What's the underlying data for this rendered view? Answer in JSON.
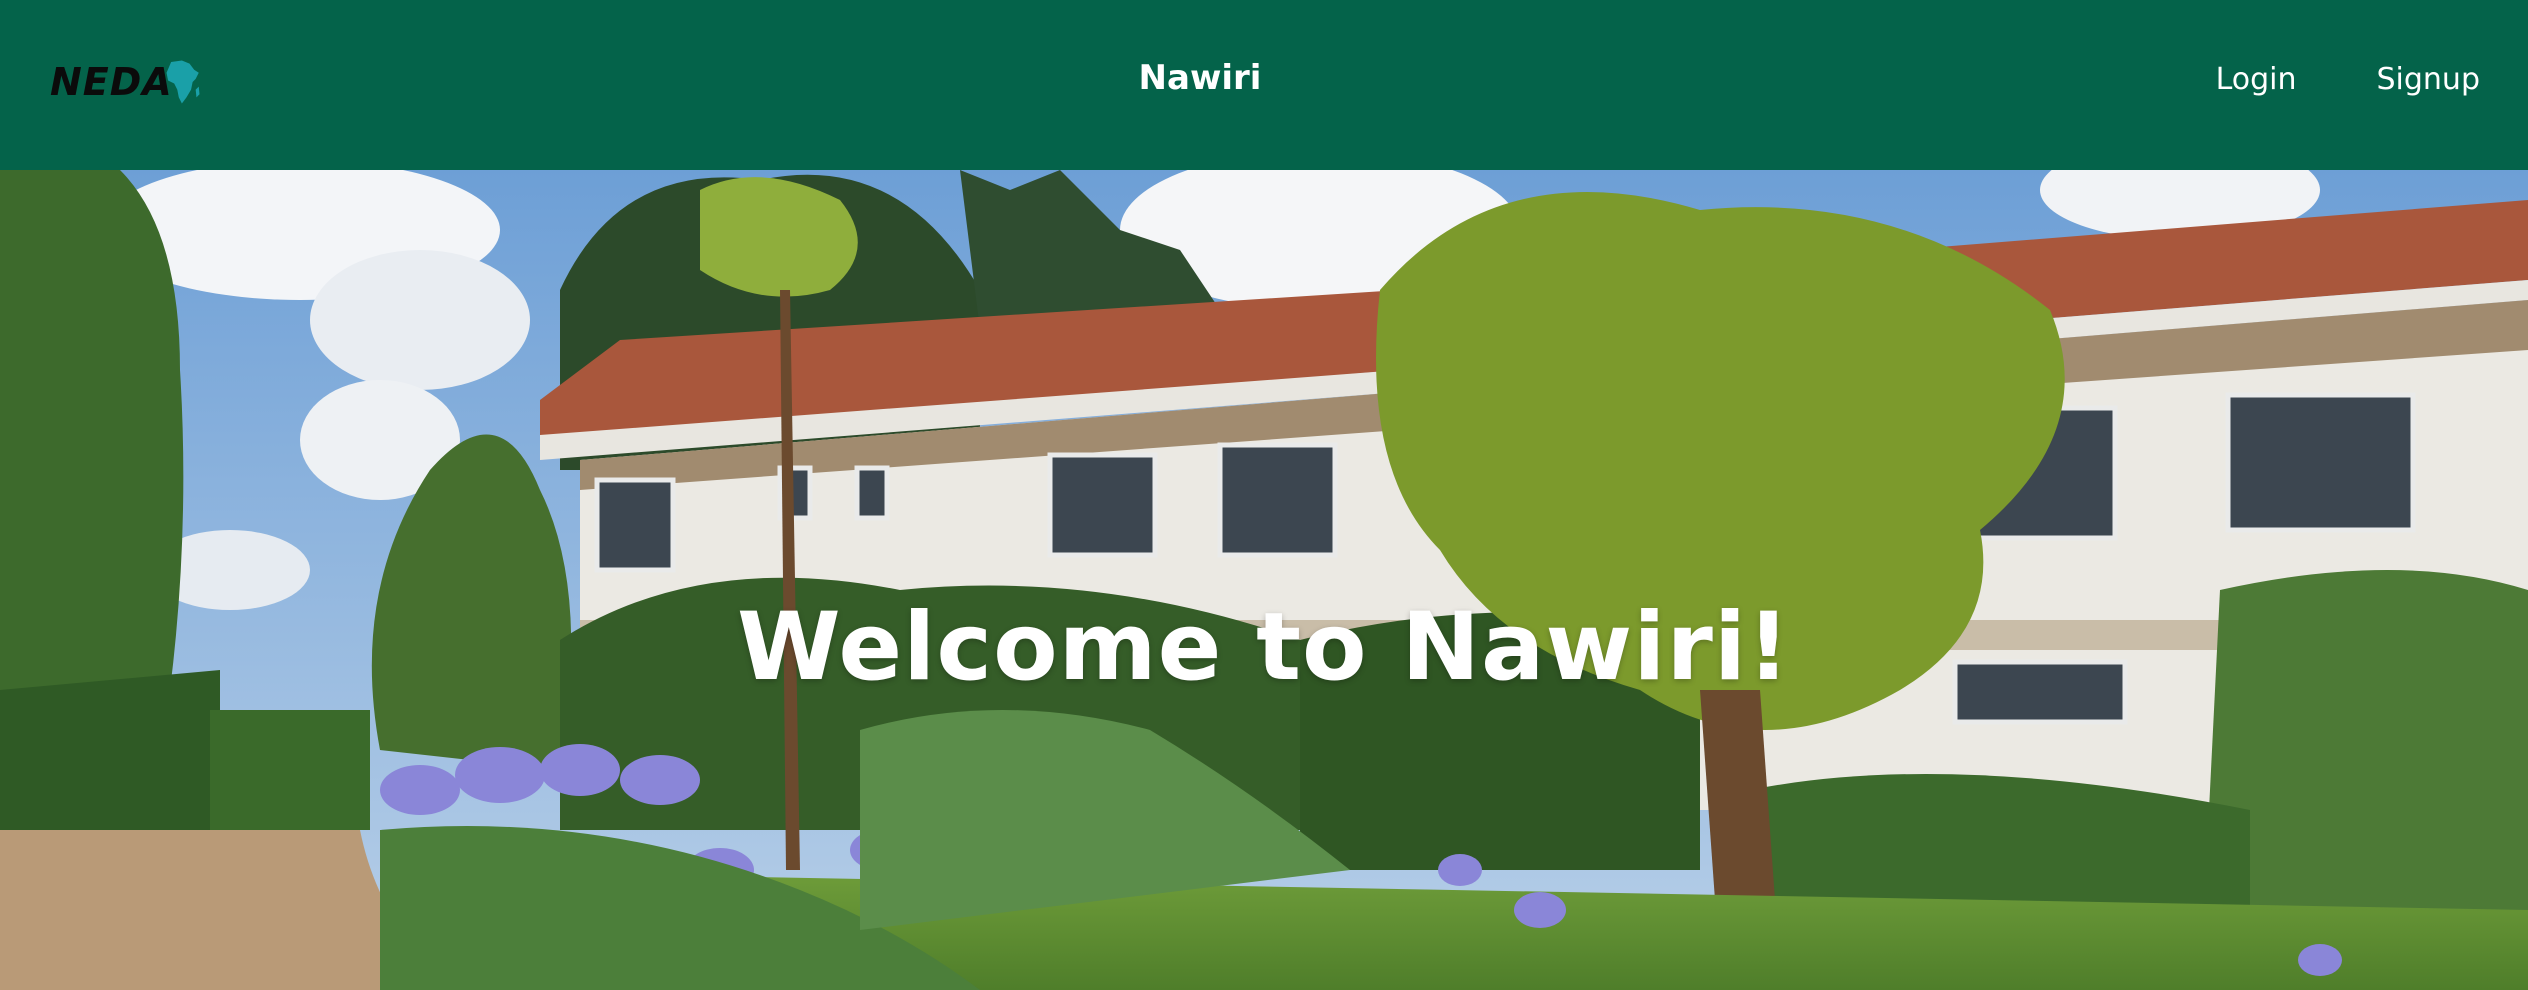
{
  "navbar": {
    "logo_text": "NEDA",
    "brand": "Nawiri",
    "links": [
      {
        "label": "Login"
      },
      {
        "label": "Signup"
      }
    ],
    "background": "#04634a",
    "logo_accent": "#1aa0a8"
  },
  "hero": {
    "title": "Welcome to Nawiri!",
    "image": "photo of a white building with red tiled roof, trees and agapanthus flowers in garden"
  }
}
